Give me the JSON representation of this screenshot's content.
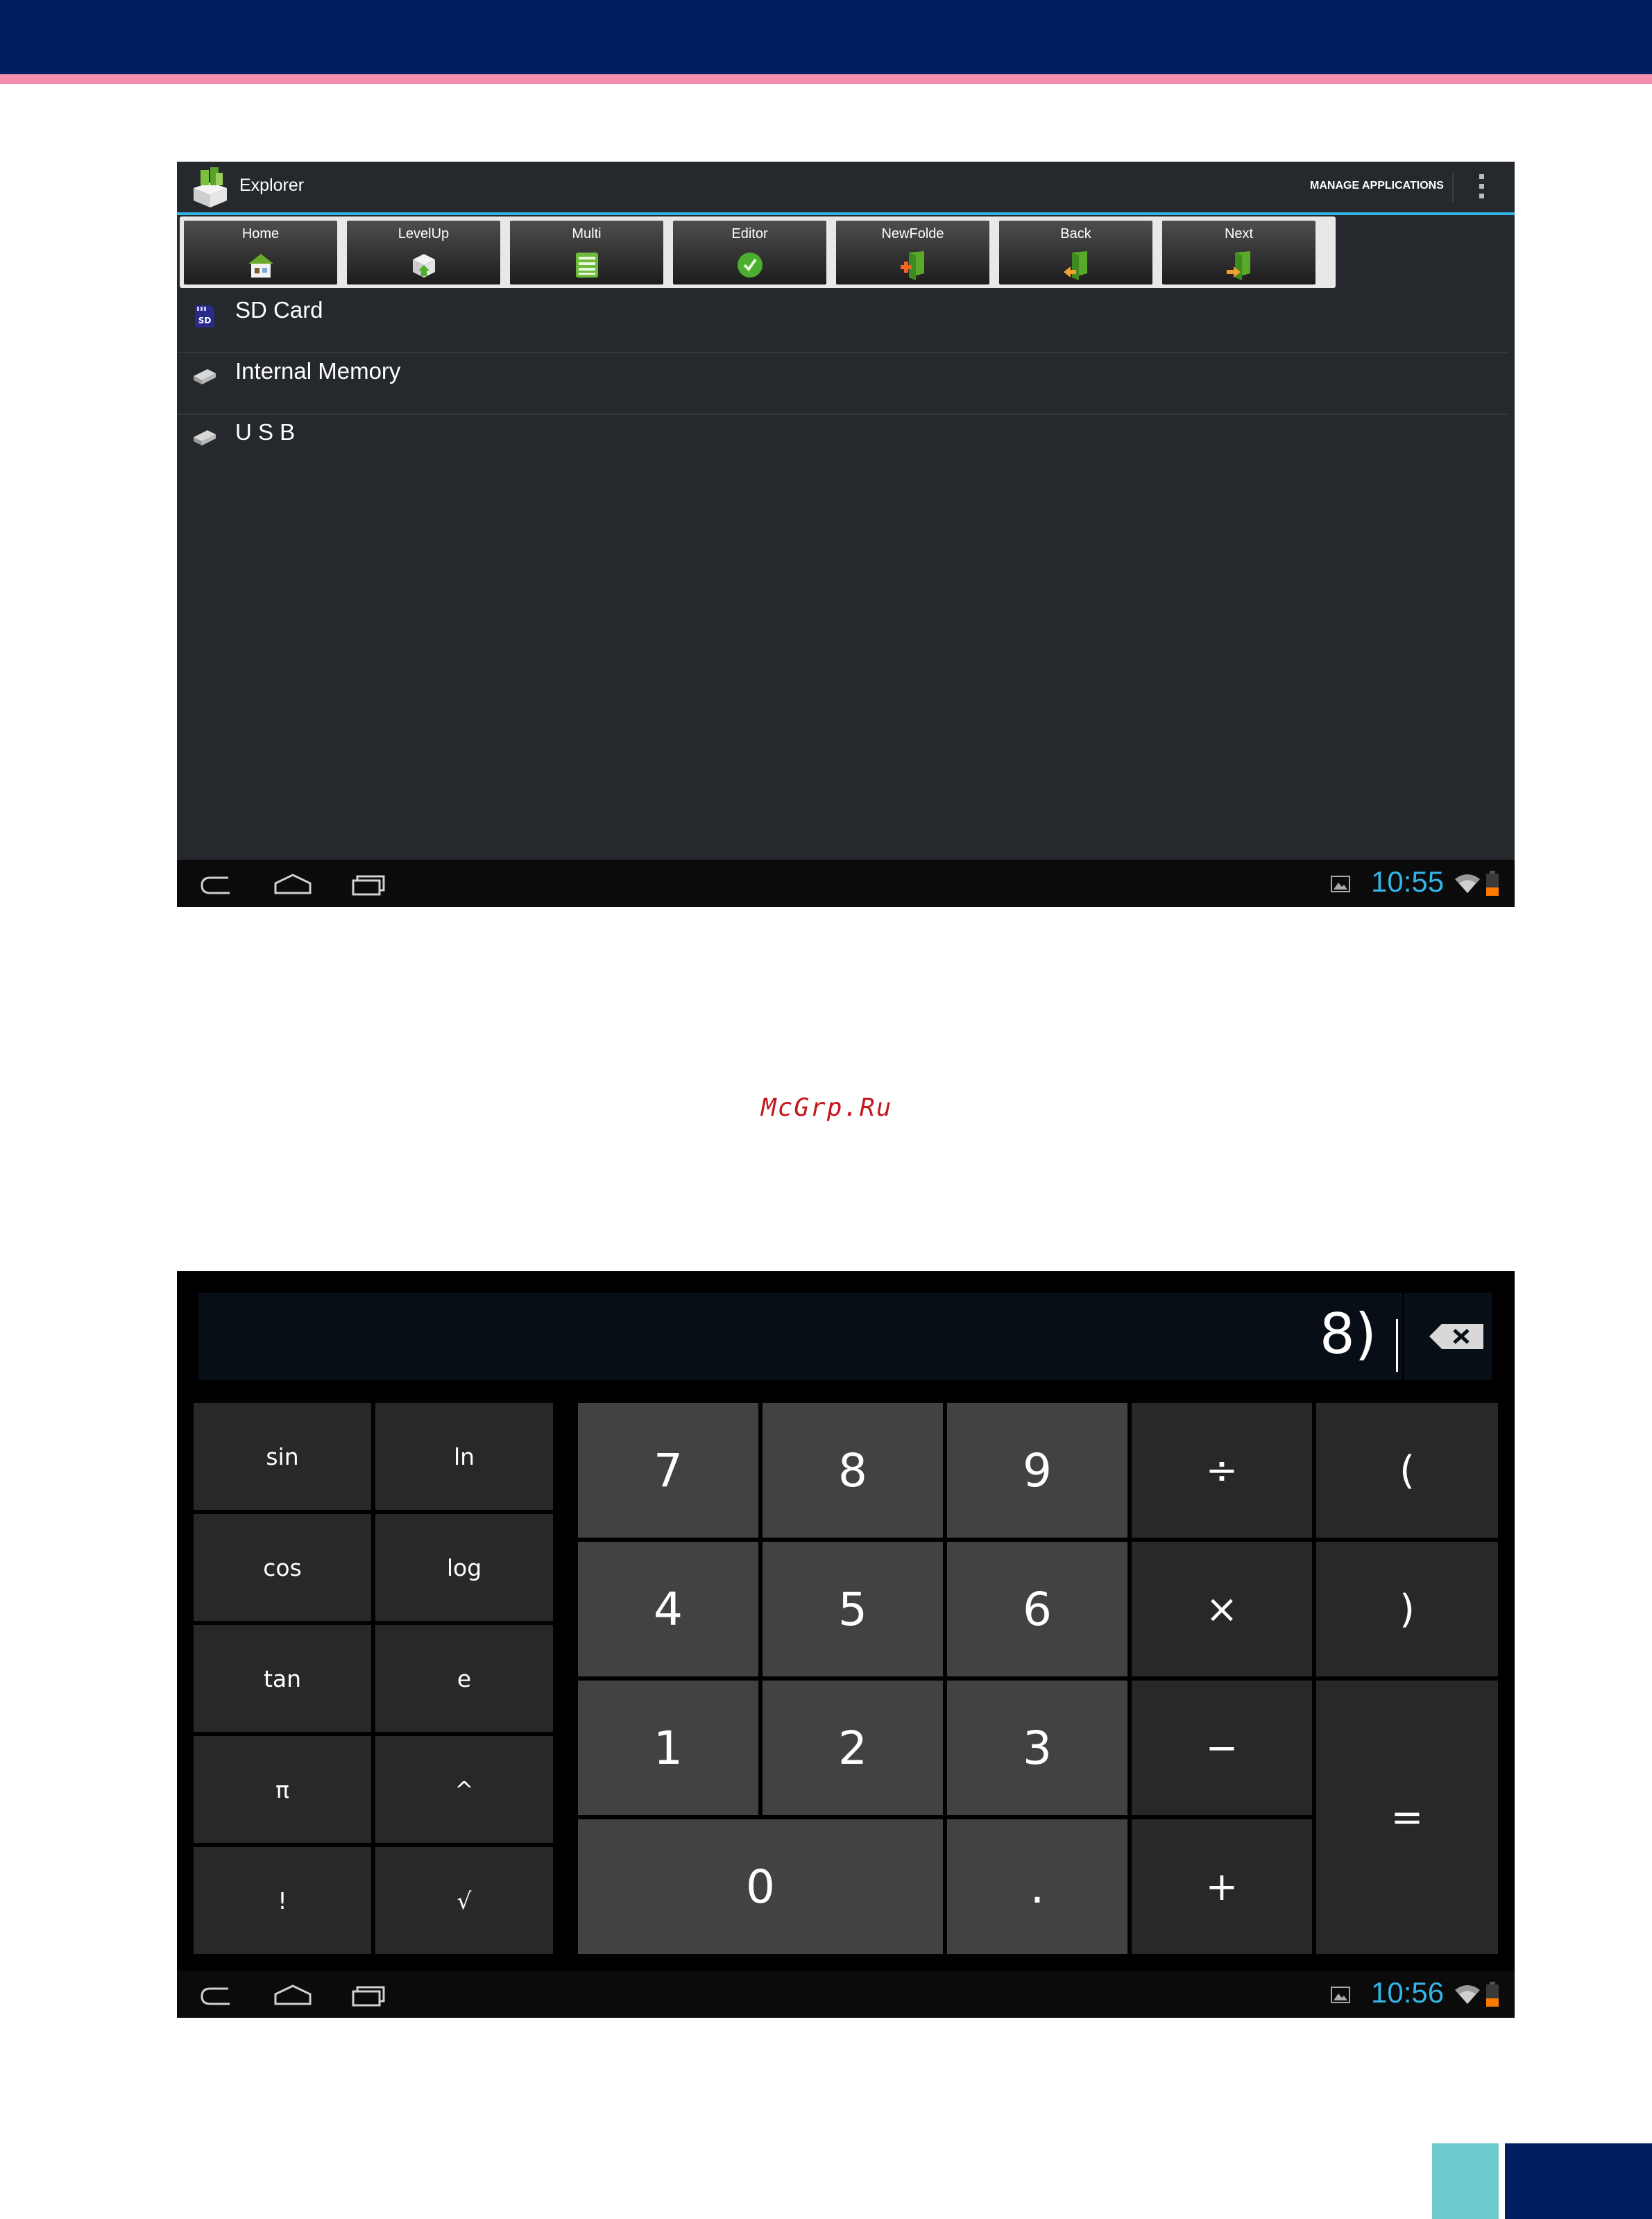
{
  "explorer": {
    "app_title": "Explorer",
    "manage_applications": "MANAGE APPLICATIONS",
    "toolbar": [
      {
        "label": "Home",
        "icon": "home-icon"
      },
      {
        "label": "LevelUp",
        "icon": "level-up-icon"
      },
      {
        "label": "Multi",
        "icon": "multi-select-icon"
      },
      {
        "label": "Editor",
        "icon": "editor-icon"
      },
      {
        "label": "NewFolde",
        "icon": "new-folder-icon"
      },
      {
        "label": "Back",
        "icon": "back-folder-icon"
      },
      {
        "label": "Next",
        "icon": "next-folder-icon"
      }
    ],
    "storage": [
      {
        "name": "SD Card",
        "icon": "sd-card-icon"
      },
      {
        "name": "Internal Memory",
        "icon": "drive-icon"
      },
      {
        "name": "U S B",
        "icon": "drive-icon"
      }
    ],
    "status_time": "10:55"
  },
  "watermark": "McGrp.Ru",
  "calculator": {
    "display": "8)",
    "advanced_keys": [
      "sin",
      "ln",
      "cos",
      "log",
      "tan",
      "e",
      "π",
      "^",
      "!",
      "√"
    ],
    "digits": [
      "7",
      "8",
      "9",
      "4",
      "5",
      "6",
      "1",
      "2",
      "3",
      "0",
      "."
    ],
    "operators": {
      "divide": "÷",
      "open_paren": "(",
      "multiply": "×",
      "close_paren": ")",
      "minus": "−",
      "plus": "+",
      "equals": "="
    },
    "status_time": "10:56"
  },
  "colors": {
    "header_navy": "#001e62",
    "header_pink": "#f58fae",
    "android_blue": "#33b5e5",
    "accent_teal": "#6cc9cc"
  }
}
